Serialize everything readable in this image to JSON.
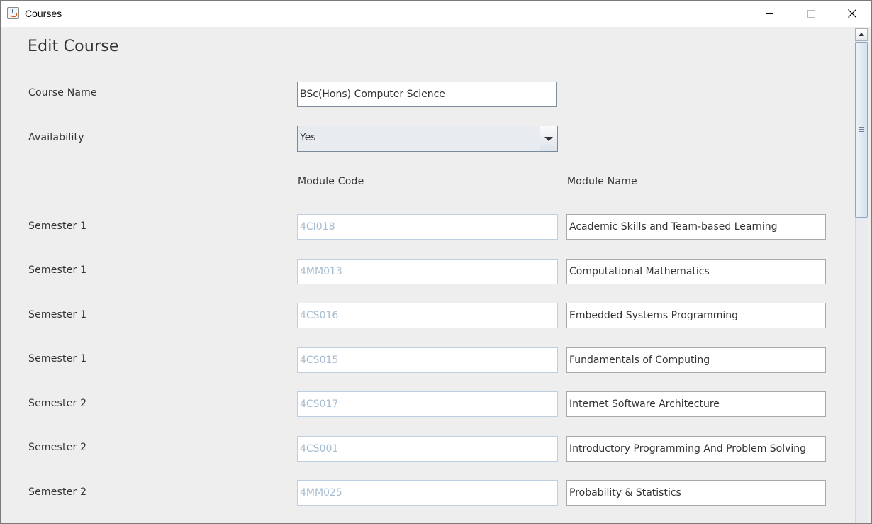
{
  "window": {
    "title": "Courses"
  },
  "form": {
    "heading": "Edit Course",
    "course_name_label": "Course Name",
    "course_name_value": "BSc(Hons) Computer Science",
    "availability_label": "Availability",
    "availability_value": "Yes",
    "module_code_header": "Module Code",
    "module_name_header": "Module Name"
  },
  "modules": [
    {
      "semester": "Semester 1",
      "code": "4CI018",
      "name": "Academic Skills and Team-based Learning"
    },
    {
      "semester": "Semester 1",
      "code": "4MM013",
      "name": "Computational Mathematics"
    },
    {
      "semester": "Semester 1",
      "code": "4CS016",
      "name": "Embedded Systems Programming"
    },
    {
      "semester": "Semester 1",
      "code": "4CS015",
      "name": "Fundamentals of Computing"
    },
    {
      "semester": "Semester 2",
      "code": "4CS017",
      "name": "Internet Software Architecture"
    },
    {
      "semester": "Semester 2",
      "code": "4CS001",
      "name": "Introductory Programming And Problem Solving"
    },
    {
      "semester": "Semester 2",
      "code": "4MM025",
      "name": "Probability & Statistics"
    }
  ],
  "icons": {
    "app": "java-cup-icon",
    "minimize": "minimize-icon",
    "maximize": "maximize-icon",
    "close": "close-icon",
    "dropdown": "chevron-down-icon",
    "scroll_up": "scroll-up-icon"
  },
  "colors": {
    "background": "#eeeeee",
    "text": "#333333",
    "disabled_text": "#a7bcd0",
    "field_border": "#a9a9a9",
    "disabled_border": "#bcd0e2"
  }
}
